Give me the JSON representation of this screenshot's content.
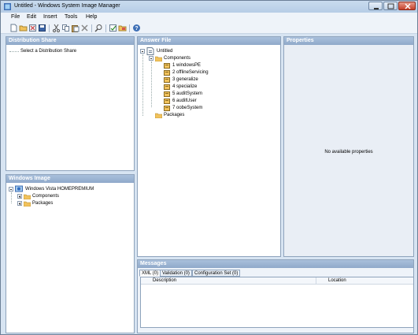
{
  "window": {
    "title": "Untitled - Windows System Image Manager"
  },
  "menu": [
    "File",
    "Edit",
    "Insert",
    "Tools",
    "Help"
  ],
  "toolbar": {
    "icons": [
      "new-answer-file-icon",
      "open-answer-file-icon",
      "close-answer-file-icon",
      "save-icon",
      "cut-icon",
      "copy-icon",
      "paste-icon",
      "delete-icon",
      "find-icon",
      "validate-icon",
      "create-configuration-set-icon",
      "help-icon"
    ]
  },
  "distribution_share": {
    "header": "Distribution Share",
    "placeholder": "Select a Distribution Share"
  },
  "windows_image": {
    "header": "Windows Image",
    "root": "Windows Vista HOMEPREMIUM",
    "children": [
      "Components",
      "Packages"
    ]
  },
  "answer_file": {
    "header": "Answer File",
    "root": "Untitled",
    "components_label": "Components",
    "passes": [
      "1 windowsPE",
      "2 offlineServicing",
      "3 generalize",
      "4 specialize",
      "5 auditSystem",
      "6 auditUser",
      "7 oobeSystem"
    ],
    "packages_label": "Packages"
  },
  "properties": {
    "header": "Properties",
    "empty_text": "No available properties"
  },
  "messages": {
    "header": "Messages",
    "tabs": [
      "XML (0)",
      "Validation (0)",
      "Configuration Set (0)"
    ],
    "columns": [
      "Description",
      "Location"
    ]
  },
  "colors": {
    "frame": "#d7e4f2",
    "pane_header": "#8fa9c9",
    "folder": "#f1c25c"
  }
}
